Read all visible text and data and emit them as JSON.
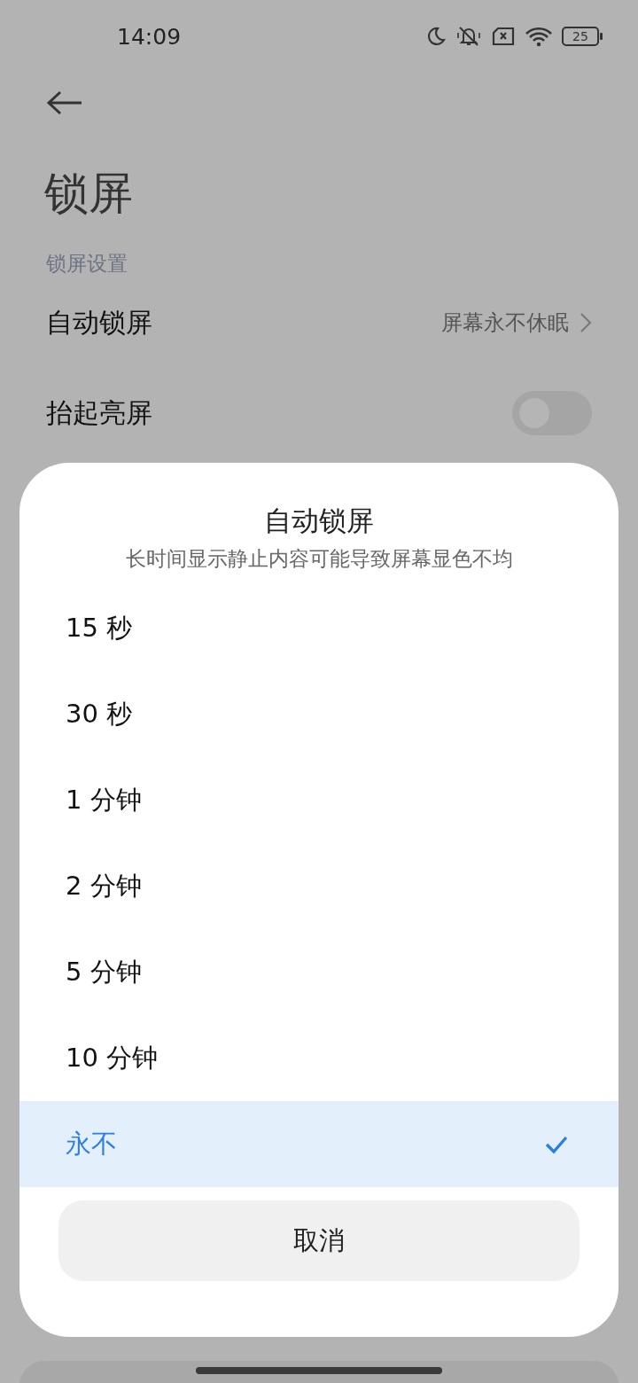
{
  "status_bar": {
    "time": "14:09",
    "battery": "25"
  },
  "page": {
    "title": "锁屏",
    "section": "锁屏设置",
    "rows": [
      {
        "kind": "link",
        "label": "自动锁屏",
        "value": "屏幕永不休眠"
      },
      {
        "kind": "toggle",
        "label": "抬起亮屏",
        "on": false
      }
    ]
  },
  "dialog": {
    "title": "自动锁屏",
    "subtitle": "长时间显示静止内容可能导致屏幕显色不均",
    "options": [
      {
        "label": "15 秒",
        "selected": false
      },
      {
        "label": "30 秒",
        "selected": false
      },
      {
        "label": "1 分钟",
        "selected": false
      },
      {
        "label": "2 分钟",
        "selected": false
      },
      {
        "label": "5 分钟",
        "selected": false
      },
      {
        "label": "10 分钟",
        "selected": false
      },
      {
        "label": "永不",
        "selected": true
      }
    ],
    "cancel": "取消"
  }
}
